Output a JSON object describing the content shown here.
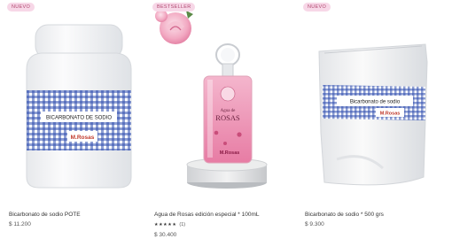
{
  "products": [
    {
      "badge": "NUEVO",
      "label_text": "BICARBONATO DE SODIO",
      "brand": "M.Rosas",
      "title": "Bicarbonato de sodio POTE",
      "price": "$ 11.200"
    },
    {
      "badge": "BESTSELLER",
      "label_text_1": "Agua de",
      "label_text_2": "ROSAS",
      "brand": "M.Rosas",
      "title": "Agua de Rosas edición especial * 100mL",
      "stars": "★★★★★",
      "rating_count": "(1)",
      "price": "$ 30.400"
    },
    {
      "badge": "NUEVO",
      "label_text": "Bicarbonato de sodio",
      "brand": "M.Rosas",
      "title": "Bicarbonato de sodio * 500 grs",
      "price": "$ 9.300"
    }
  ],
  "colors": {
    "badge_bg": "#f7d7e7",
    "badge_text": "#b0476f",
    "gingham_blue": "#2f4fae",
    "rose_pink": "#e98bb0"
  }
}
